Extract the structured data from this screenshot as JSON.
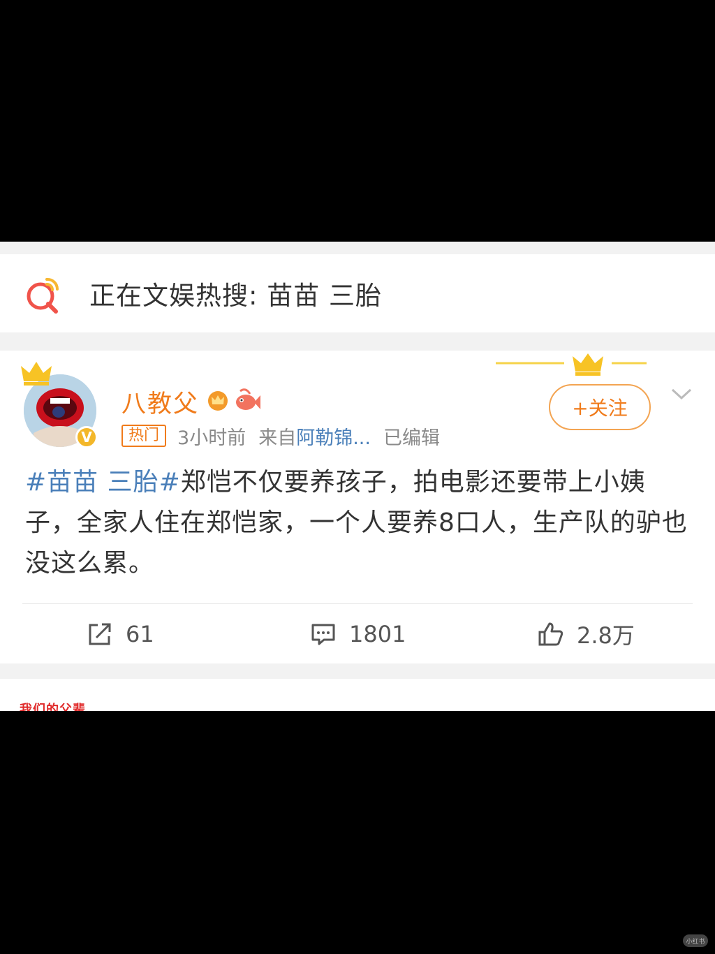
{
  "hot_search": {
    "text": "正在文娱热搜: 苗苗 三胎",
    "icon": "search-q-icon"
  },
  "post": {
    "username": "八教父",
    "badges": [
      "vip-crown-icon",
      "fish-icon"
    ],
    "hot_tag": "热门",
    "time": "3小时前",
    "from_label": "来自",
    "source": "阿勒锦...",
    "edited": "已编辑",
    "follow_label": "+关注",
    "topic": "#苗苗 三胎#",
    "content": "郑恺不仅要养孩子，拍电影还要带上小姨子，全家人住在郑恺家，一个人要养8口人，生产队的驴也没这么累。",
    "reposts": "61",
    "comments": "1801",
    "likes": "2.8万"
  },
  "next_card": {
    "logo_text": "我们的父辈"
  },
  "watermark": "小红书",
  "colors": {
    "accent_orange": "#f07b1b",
    "link_blue": "#4a7fb9",
    "background": "#f2f2f2"
  }
}
